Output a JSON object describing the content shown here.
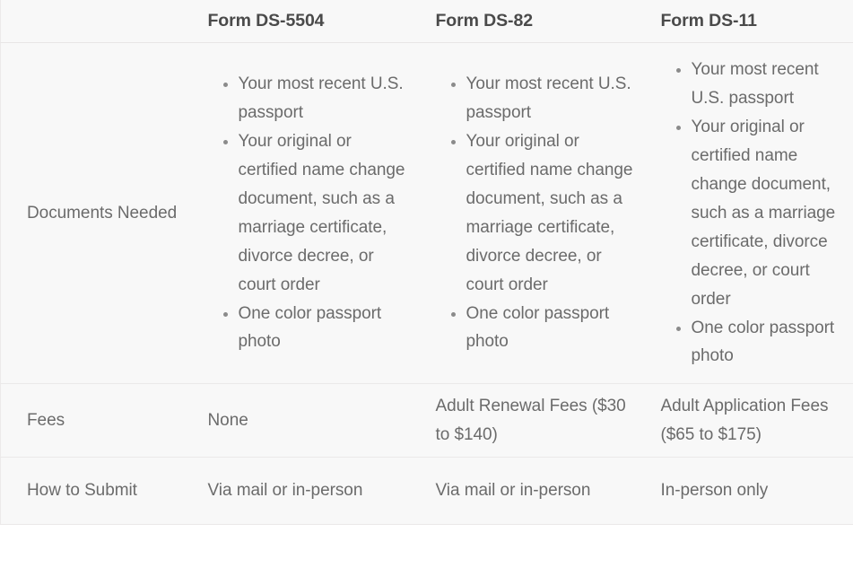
{
  "table": {
    "headers": {
      "label_column": "",
      "columns": [
        "Form DS-5504",
        "Form DS-82",
        "Form DS-11"
      ]
    },
    "rows": [
      {
        "label": "Documents Needed",
        "type": "list",
        "cells": [
          [
            "Your most recent U.S. passport",
            "Your original or certified name change document, such as a marriage certificate, divorce decree, or court order",
            "One color passport photo"
          ],
          [
            "Your most recent U.S. passport",
            "Your original or certified name change document, such as a marriage certificate, divorce decree, or court order",
            "One color passport photo"
          ],
          [
            "Your most recent U.S. passport",
            "Your original or certified name change document, such as a marriage certificate, divorce decree, or court order",
            "One color passport photo"
          ]
        ]
      },
      {
        "label": "Fees",
        "type": "text",
        "cells": [
          "None",
          "Adult Renewal Fees ($30 to $140)",
          "Adult Application Fees ($65 to $175)"
        ]
      },
      {
        "label": "How to Submit",
        "type": "text",
        "cells": [
          "Via mail or in-person",
          "Via mail or in-person",
          "In-person only"
        ]
      }
    ]
  },
  "colors": {
    "background": "#f8f8f8",
    "header_text": "#4a4a4a",
    "body_text": "#6b6b6b",
    "divider": "#ebe9e9",
    "bullet": "#8b8b8b"
  }
}
